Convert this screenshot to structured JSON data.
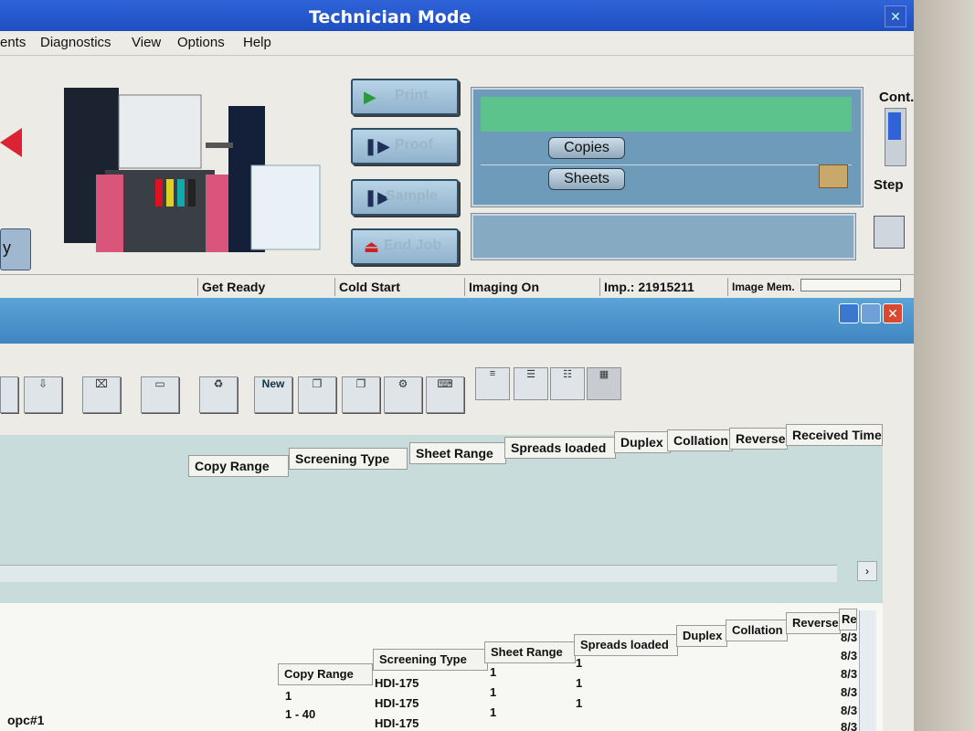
{
  "window": {
    "title": "Technician Mode"
  },
  "menu": [
    "ents",
    "Diagnostics",
    "View",
    "Options",
    "Help"
  ],
  "actions": {
    "print": "Print",
    "proof": "Proof",
    "sample": "Sample",
    "end_job": "End Job"
  },
  "queue": {
    "copies": "Copies",
    "sheets": "Sheets"
  },
  "side": {
    "cont": "Cont.",
    "step": "Step"
  },
  "left_button_label": "y",
  "status": {
    "state": "Get Ready",
    "cold_start": "Cold Start",
    "imaging": "Imaging On",
    "impressions": "Imp.: 21915211",
    "image_mem": "Image Mem."
  },
  "toolbar": {
    "new_label": "New"
  },
  "grid1": {
    "columns": [
      "Copy Range",
      "Screening Type",
      "Sheet Range",
      "Spreads loaded",
      "Duplex",
      "Collation",
      "Reverse",
      "Received Time"
    ]
  },
  "grid2": {
    "columns": [
      "Copy Range",
      "Screening Type",
      "Sheet Range",
      "Spreads loaded",
      "Duplex",
      "Collation",
      "Reverse",
      "Re"
    ],
    "rows": [
      {
        "copy_range": "1",
        "screening": "HDI-175",
        "sheet_range": "1",
        "spreads": "1",
        "received": "8/3"
      },
      {
        "copy_range": "1 - 40",
        "screening": "HDI-175",
        "sheet_range": "1",
        "spreads": "1",
        "received": "8/3"
      },
      {
        "copy_range": "",
        "screening": "HDI-175",
        "sheet_range": "1",
        "spreads": "1",
        "received": "8/3"
      }
    ],
    "received_extra": [
      "8/3",
      "8/3",
      "8/3"
    ],
    "name_cell": "opc#1"
  },
  "colors": {
    "title_blue": "#2f63d8",
    "queue_green": "#5cc38c",
    "grid_teal": "#c8dcdc"
  }
}
